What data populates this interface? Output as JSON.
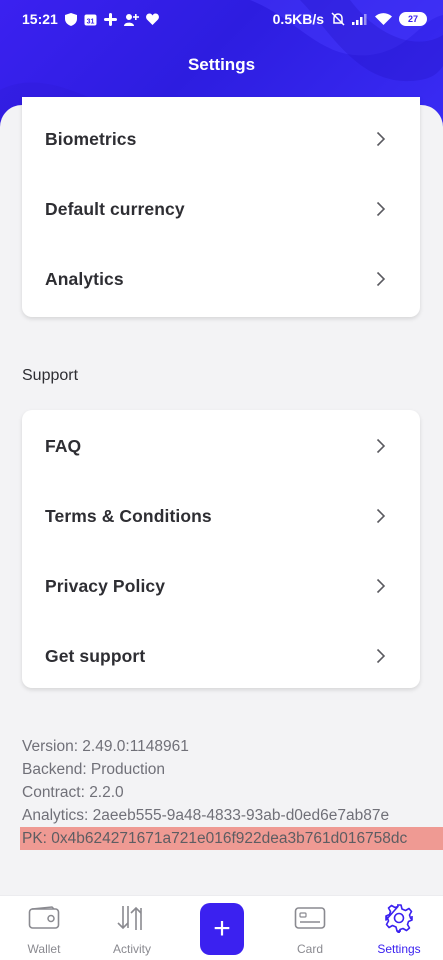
{
  "status_bar": {
    "time": "15:21",
    "speed": "0.5KB/s",
    "battery": "27"
  },
  "header": {
    "title": "Settings"
  },
  "security_card": {
    "items": [
      {
        "label": "Biometrics"
      },
      {
        "label": "Default currency"
      },
      {
        "label": "Analytics"
      }
    ]
  },
  "support_section": {
    "title": "Support",
    "items": [
      {
        "label": "FAQ"
      },
      {
        "label": "Terms & Conditions"
      },
      {
        "label": "Privacy Policy"
      },
      {
        "label": "Get support"
      }
    ]
  },
  "app_info": {
    "version": "Version: 2.49.0:1148961",
    "backend": "Backend: Production",
    "contract": "Contract: 2.2.0",
    "analytics": "Analytics: 2aeeb555-9a48-4833-93ab-d0ed6e7ab87e",
    "pk": "PK: 0x4b624271671a721e016f922dea3b761d016758dc"
  },
  "bottom_nav": {
    "wallet": "Wallet",
    "activity": "Activity",
    "add": "+",
    "card": "Card",
    "settings": "Settings"
  },
  "colors": {
    "accent": "#3b21f0",
    "highlight": "#ef9a93",
    "background": "#f3f3f5"
  }
}
